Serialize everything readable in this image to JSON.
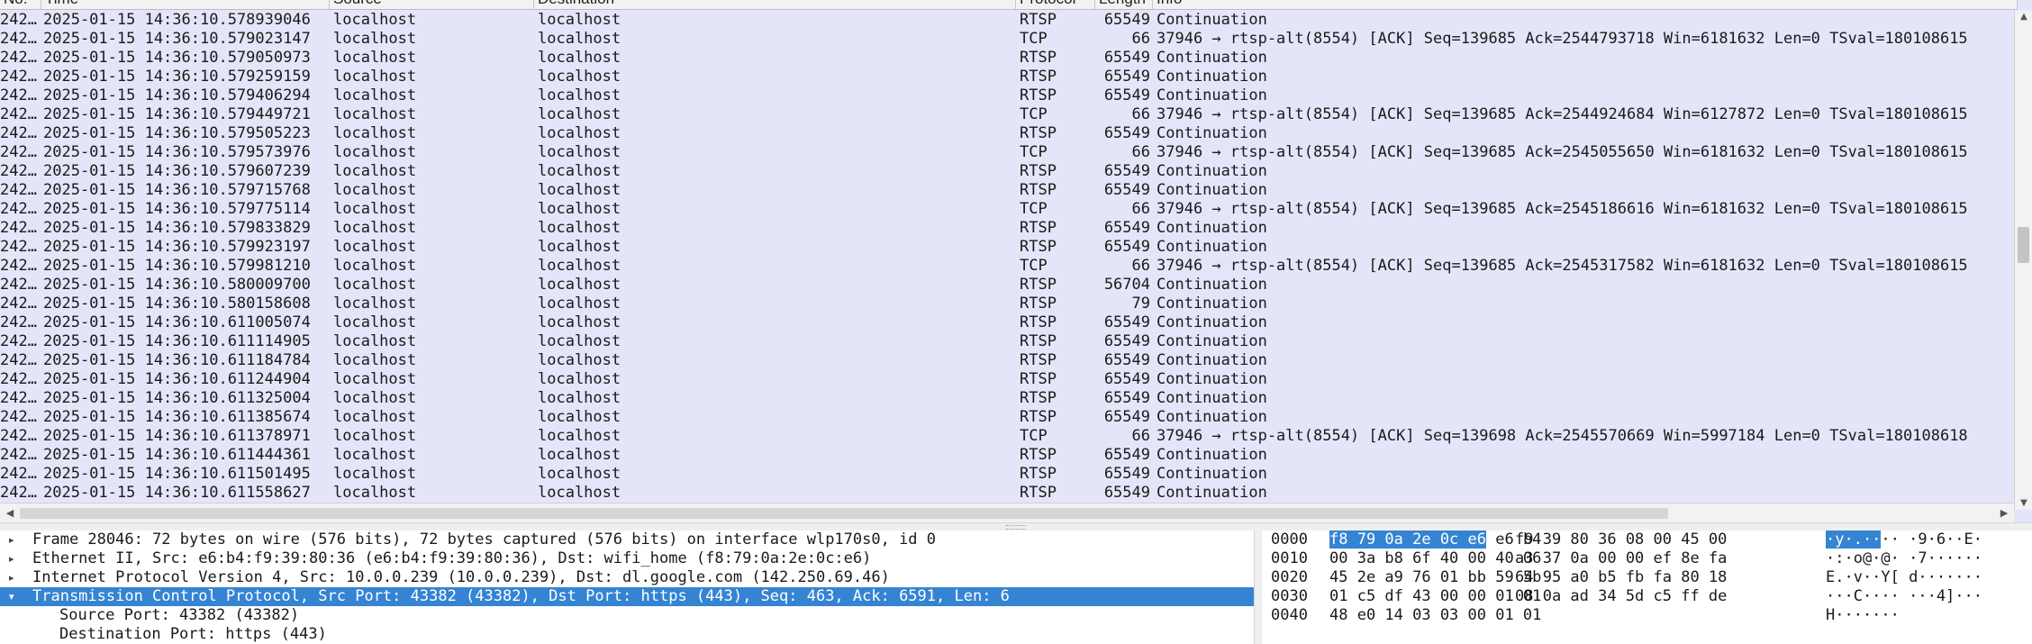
{
  "columns": [
    "No.",
    "Time",
    "Source",
    "Destination",
    "Protocol",
    "Length",
    "Info"
  ],
  "packets": [
    {
      "no": "242…",
      "time": "2025-01-15 14:36:10.578939046",
      "src": "localhost",
      "dst": "localhost",
      "proto": "RTSP",
      "len": "65549",
      "info": "Continuation"
    },
    {
      "no": "242…",
      "time": "2025-01-15 14:36:10.579023147",
      "src": "localhost",
      "dst": "localhost",
      "proto": "TCP",
      "len": "66",
      "info": "37946 → rtsp-alt(8554) [ACK] Seq=139685 Ack=2544793718 Win=6181632 Len=0 TSval=180108615"
    },
    {
      "no": "242…",
      "time": "2025-01-15 14:36:10.579050973",
      "src": "localhost",
      "dst": "localhost",
      "proto": "RTSP",
      "len": "65549",
      "info": "Continuation"
    },
    {
      "no": "242…",
      "time": "2025-01-15 14:36:10.579259159",
      "src": "localhost",
      "dst": "localhost",
      "proto": "RTSP",
      "len": "65549",
      "info": "Continuation"
    },
    {
      "no": "242…",
      "time": "2025-01-15 14:36:10.579406294",
      "src": "localhost",
      "dst": "localhost",
      "proto": "RTSP",
      "len": "65549",
      "info": "Continuation"
    },
    {
      "no": "242…",
      "time": "2025-01-15 14:36:10.579449721",
      "src": "localhost",
      "dst": "localhost",
      "proto": "TCP",
      "len": "66",
      "info": "37946 → rtsp-alt(8554) [ACK] Seq=139685 Ack=2544924684 Win=6127872 Len=0 TSval=180108615"
    },
    {
      "no": "242…",
      "time": "2025-01-15 14:36:10.579505223",
      "src": "localhost",
      "dst": "localhost",
      "proto": "RTSP",
      "len": "65549",
      "info": "Continuation"
    },
    {
      "no": "242…",
      "time": "2025-01-15 14:36:10.579573976",
      "src": "localhost",
      "dst": "localhost",
      "proto": "TCP",
      "len": "66",
      "info": "37946 → rtsp-alt(8554) [ACK] Seq=139685 Ack=2545055650 Win=6181632 Len=0 TSval=180108615"
    },
    {
      "no": "242…",
      "time": "2025-01-15 14:36:10.579607239",
      "src": "localhost",
      "dst": "localhost",
      "proto": "RTSP",
      "len": "65549",
      "info": "Continuation"
    },
    {
      "no": "242…",
      "time": "2025-01-15 14:36:10.579715768",
      "src": "localhost",
      "dst": "localhost",
      "proto": "RTSP",
      "len": "65549",
      "info": "Continuation"
    },
    {
      "no": "242…",
      "time": "2025-01-15 14:36:10.579775114",
      "src": "localhost",
      "dst": "localhost",
      "proto": "TCP",
      "len": "66",
      "info": "37946 → rtsp-alt(8554) [ACK] Seq=139685 Ack=2545186616 Win=6181632 Len=0 TSval=180108615"
    },
    {
      "no": "242…",
      "time": "2025-01-15 14:36:10.579833829",
      "src": "localhost",
      "dst": "localhost",
      "proto": "RTSP",
      "len": "65549",
      "info": "Continuation"
    },
    {
      "no": "242…",
      "time": "2025-01-15 14:36:10.579923197",
      "src": "localhost",
      "dst": "localhost",
      "proto": "RTSP",
      "len": "65549",
      "info": "Continuation"
    },
    {
      "no": "242…",
      "time": "2025-01-15 14:36:10.579981210",
      "src": "localhost",
      "dst": "localhost",
      "proto": "TCP",
      "len": "66",
      "info": "37946 → rtsp-alt(8554) [ACK] Seq=139685 Ack=2545317582 Win=6181632 Len=0 TSval=180108615"
    },
    {
      "no": "242…",
      "time": "2025-01-15 14:36:10.580009700",
      "src": "localhost",
      "dst": "localhost",
      "proto": "RTSP",
      "len": "56704",
      "info": "Continuation"
    },
    {
      "no": "242…",
      "time": "2025-01-15 14:36:10.580158608",
      "src": "localhost",
      "dst": "localhost",
      "proto": "RTSP",
      "len": "79",
      "info": "Continuation"
    },
    {
      "no": "242…",
      "time": "2025-01-15 14:36:10.611005074",
      "src": "localhost",
      "dst": "localhost",
      "proto": "RTSP",
      "len": "65549",
      "info": "Continuation"
    },
    {
      "no": "242…",
      "time": "2025-01-15 14:36:10.611114905",
      "src": "localhost",
      "dst": "localhost",
      "proto": "RTSP",
      "len": "65549",
      "info": "Continuation"
    },
    {
      "no": "242…",
      "time": "2025-01-15 14:36:10.611184784",
      "src": "localhost",
      "dst": "localhost",
      "proto": "RTSP",
      "len": "65549",
      "info": "Continuation"
    },
    {
      "no": "242…",
      "time": "2025-01-15 14:36:10.611244904",
      "src": "localhost",
      "dst": "localhost",
      "proto": "RTSP",
      "len": "65549",
      "info": "Continuation"
    },
    {
      "no": "242…",
      "time": "2025-01-15 14:36:10.611325004",
      "src": "localhost",
      "dst": "localhost",
      "proto": "RTSP",
      "len": "65549",
      "info": "Continuation"
    },
    {
      "no": "242…",
      "time": "2025-01-15 14:36:10.611385674",
      "src": "localhost",
      "dst": "localhost",
      "proto": "RTSP",
      "len": "65549",
      "info": "Continuation"
    },
    {
      "no": "242…",
      "time": "2025-01-15 14:36:10.611378971",
      "src": "localhost",
      "dst": "localhost",
      "proto": "TCP",
      "len": "66",
      "info": "37946 → rtsp-alt(8554) [ACK] Seq=139698 Ack=2545570669 Win=5997184 Len=0 TSval=180108618"
    },
    {
      "no": "242…",
      "time": "2025-01-15 14:36:10.611444361",
      "src": "localhost",
      "dst": "localhost",
      "proto": "RTSP",
      "len": "65549",
      "info": "Continuation"
    },
    {
      "no": "242…",
      "time": "2025-01-15 14:36:10.611501495",
      "src": "localhost",
      "dst": "localhost",
      "proto": "RTSP",
      "len": "65549",
      "info": "Continuation"
    },
    {
      "no": "242…",
      "time": "2025-01-15 14:36:10.611558627",
      "src": "localhost",
      "dst": "localhost",
      "proto": "RTSP",
      "len": "65549",
      "info": "Continuation"
    }
  ],
  "details": [
    {
      "text": "Frame 28046: 72 bytes on wire (576 bits), 72 bytes captured (576 bits) on interface wlp170s0, id 0",
      "expander": "right",
      "selected": false,
      "child": false
    },
    {
      "text": "Ethernet II, Src: e6:b4:f9:39:80:36 (e6:b4:f9:39:80:36), Dst: wifi_home (f8:79:0a:2e:0c:e6)",
      "expander": "right",
      "selected": false,
      "child": false
    },
    {
      "text": "Internet Protocol Version 4, Src: 10.0.0.239 (10.0.0.239), Dst: dl.google.com (142.250.69.46)",
      "expander": "right",
      "selected": false,
      "child": false
    },
    {
      "text": "Transmission Control Protocol, Src Port: 43382 (43382), Dst Port: https (443), Seq: 463, Ack: 6591, Len: 6",
      "expander": "down",
      "selected": true,
      "child": false
    },
    {
      "text": "Source Port: 43382 (43382)",
      "expander": "",
      "selected": false,
      "child": true
    },
    {
      "text": "Destination Port: https (443)",
      "expander": "",
      "selected": false,
      "child": true
    }
  ],
  "bytes": [
    {
      "offset": "0000",
      "hl1": "f8 79 0a 2e 0c e6",
      "hex1": " e6 b4",
      "hex2": "f9 39 80 36 08 00 45 00",
      "ahl": "·y·.··",
      "ascii": "·· ·9·6··E·"
    },
    {
      "offset": "0010",
      "hl1": "",
      "hex1": "00 3a b8 6f 40 00 40 06",
      "hex2": "a3 37 0a 00 00 ef 8e fa",
      "ahl": "",
      "ascii": "·:·o@·@· ·7······"
    },
    {
      "offset": "0020",
      "hl1": "",
      "hex1": "45 2e a9 76 01 bb 59 5b",
      "hex2": "64 95 a0 b5 fb fa 80 18",
      "ahl": "",
      "ascii": "E.·v··Y[ d·······"
    },
    {
      "offset": "0030",
      "hl1": "",
      "hex1": "01 c5 df 43 00 00 01 01",
      "hex2": "08 0a ad 34 5d c5 ff de",
      "ahl": "",
      "ascii": "···C···· ···4]···"
    },
    {
      "offset": "0040",
      "hl1": "",
      "hex1": "48 e0 14 03 03 00 01 01",
      "hex2": "",
      "ahl": "",
      "ascii": "H·······"
    }
  ],
  "icons": {
    "expand_right": "▸",
    "expand_down": "▾",
    "arrow_up": "▲",
    "arrow_down": "▼",
    "arrow_left": "◀",
    "arrow_right": "▶"
  },
  "colors": {
    "row_bg": "#e5e5fa",
    "selection": "#3584d3"
  }
}
